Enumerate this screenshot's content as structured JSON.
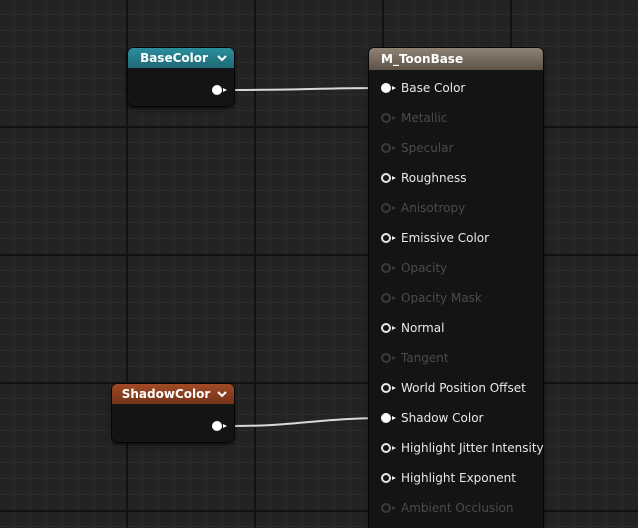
{
  "base_color_node": {
    "title": "BaseColor"
  },
  "shadow_color_node": {
    "title": "ShadowColor"
  },
  "material_node": {
    "title": "M_ToonBase",
    "inputs": [
      {
        "label": "Base Color",
        "enabled": true,
        "connected": true
      },
      {
        "label": "Metallic",
        "enabled": false,
        "connected": false
      },
      {
        "label": "Specular",
        "enabled": false,
        "connected": false
      },
      {
        "label": "Roughness",
        "enabled": true,
        "connected": false
      },
      {
        "label": "Anisotropy",
        "enabled": false,
        "connected": false
      },
      {
        "label": "Emissive Color",
        "enabled": true,
        "connected": false
      },
      {
        "label": "Opacity",
        "enabled": false,
        "connected": false
      },
      {
        "label": "Opacity Mask",
        "enabled": false,
        "connected": false
      },
      {
        "label": "Normal",
        "enabled": true,
        "connected": false
      },
      {
        "label": "Tangent",
        "enabled": false,
        "connected": false
      },
      {
        "label": "World Position Offset",
        "enabled": true,
        "connected": false
      },
      {
        "label": "Shadow Color",
        "enabled": true,
        "connected": true
      },
      {
        "label": "Highlight Jitter Intensity",
        "enabled": true,
        "connected": false
      },
      {
        "label": "Highlight Exponent",
        "enabled": true,
        "connected": false
      },
      {
        "label": "Ambient Occlusion",
        "enabled": false,
        "connected": false
      }
    ]
  },
  "colors": {
    "grid_background": "#232323",
    "base_color_header": "#2b8e9c",
    "shadow_color_header": "#a14a26",
    "material_header": "#8f8275",
    "wire": "#d9d9d9"
  }
}
